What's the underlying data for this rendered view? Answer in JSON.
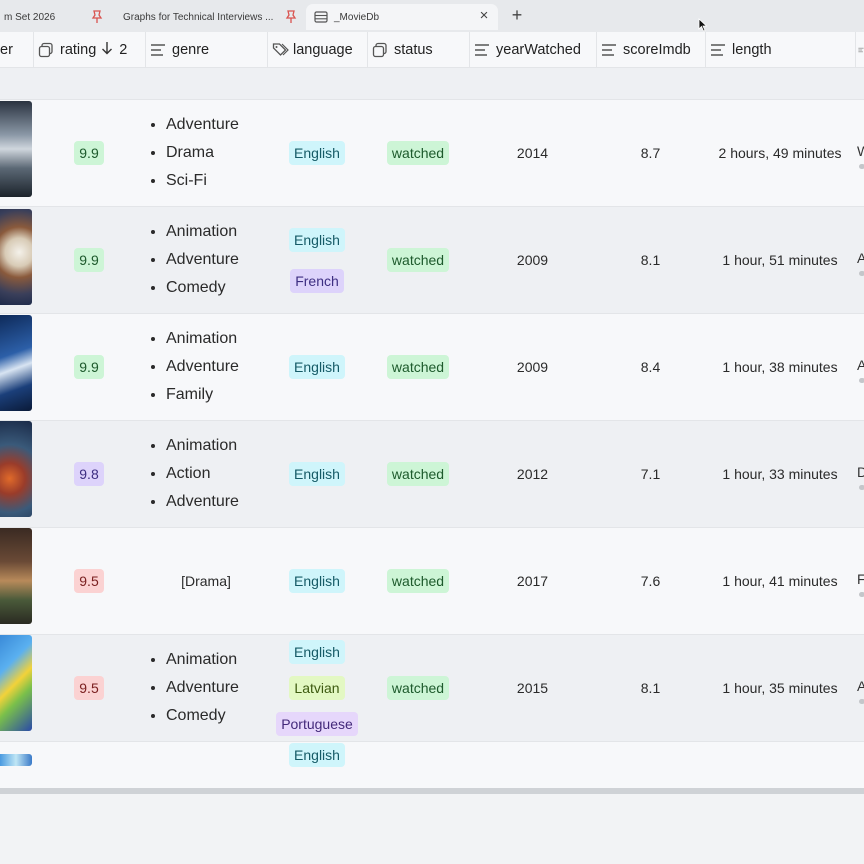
{
  "tabs": [
    {
      "label": "m Set 2026"
    },
    {
      "label": "Graphs for Technical Interviews ..."
    },
    {
      "label": "_MovieDb"
    }
  ],
  "columns": {
    "partial": "er",
    "rating": "rating",
    "rating_sort": "2",
    "genre": "genre",
    "language": "language",
    "status": "status",
    "yearWatched": "yearWatched",
    "scoreImdb": "scoreImdb",
    "length": "length"
  },
  "rows": [
    {
      "rating": "9.9",
      "rating_color": "green",
      "genres": [
        "Adventure",
        "Drama",
        "Sci-Fi"
      ],
      "languages": [
        "English"
      ],
      "status": "watched",
      "yearWatched": "2014",
      "scoreImdb": "8.7",
      "length": "2 hours, 49 minutes",
      "edge": "W"
    },
    {
      "rating": "9.9",
      "rating_color": "green",
      "genres": [
        "Animation",
        "Adventure",
        "Comedy"
      ],
      "languages": [
        "English",
        "French"
      ],
      "status": "watched",
      "yearWatched": "2009",
      "scoreImdb": "8.1",
      "length": "1 hour, 51 minutes",
      "edge": "A"
    },
    {
      "rating": "9.9",
      "rating_color": "green",
      "genres": [
        "Animation",
        "Adventure",
        "Family"
      ],
      "languages": [
        "English"
      ],
      "status": "watched",
      "yearWatched": "2009",
      "scoreImdb": "8.4",
      "length": "1 hour, 38 minutes",
      "edge": "A"
    },
    {
      "rating": "9.8",
      "rating_color": "purple",
      "genres": [
        "Animation",
        "Action",
        "Adventure"
      ],
      "languages": [
        "English"
      ],
      "status": "watched",
      "yearWatched": "2012",
      "scoreImdb": "7.1",
      "length": "1 hour, 33 minutes",
      "edge": "D"
    },
    {
      "rating": "9.5",
      "rating_color": "red",
      "genre_text": "[Drama]",
      "languages": [
        "English"
      ],
      "status": "watched",
      "yearWatched": "2017",
      "scoreImdb": "7.6",
      "length": "1 hour, 41 minutes",
      "edge": "F"
    },
    {
      "rating": "9.5",
      "rating_color": "red",
      "genres": [
        "Animation",
        "Adventure",
        "Comedy"
      ],
      "languages": [
        "English",
        "Latvian",
        "Portuguese"
      ],
      "status": "watched",
      "yearWatched": "2015",
      "scoreImdb": "8.1",
      "length": "1 hour, 35 minutes",
      "edge": "A"
    }
  ],
  "partial_row": {
    "languages": [
      "English"
    ]
  },
  "colors": {
    "badge_green": "#cdf5d6",
    "badge_purple": "#ddd3fb",
    "badge_red": "#fbd2d2",
    "lang_english": "#cff5fb",
    "lang_french": "#ddd3fb",
    "lang_latvian": "#e3f8c3",
    "lang_portuguese": "#e6d7fb"
  },
  "icons": {
    "tab_pin": "pin-icon",
    "tab_db": "database-icon",
    "close": "close-icon",
    "new_tab": "plus-icon",
    "rating": "number-icon",
    "sort": "arrow-down-icon",
    "text_column": "text-lines-icon",
    "language": "tags-icon",
    "status": "select-icon"
  }
}
